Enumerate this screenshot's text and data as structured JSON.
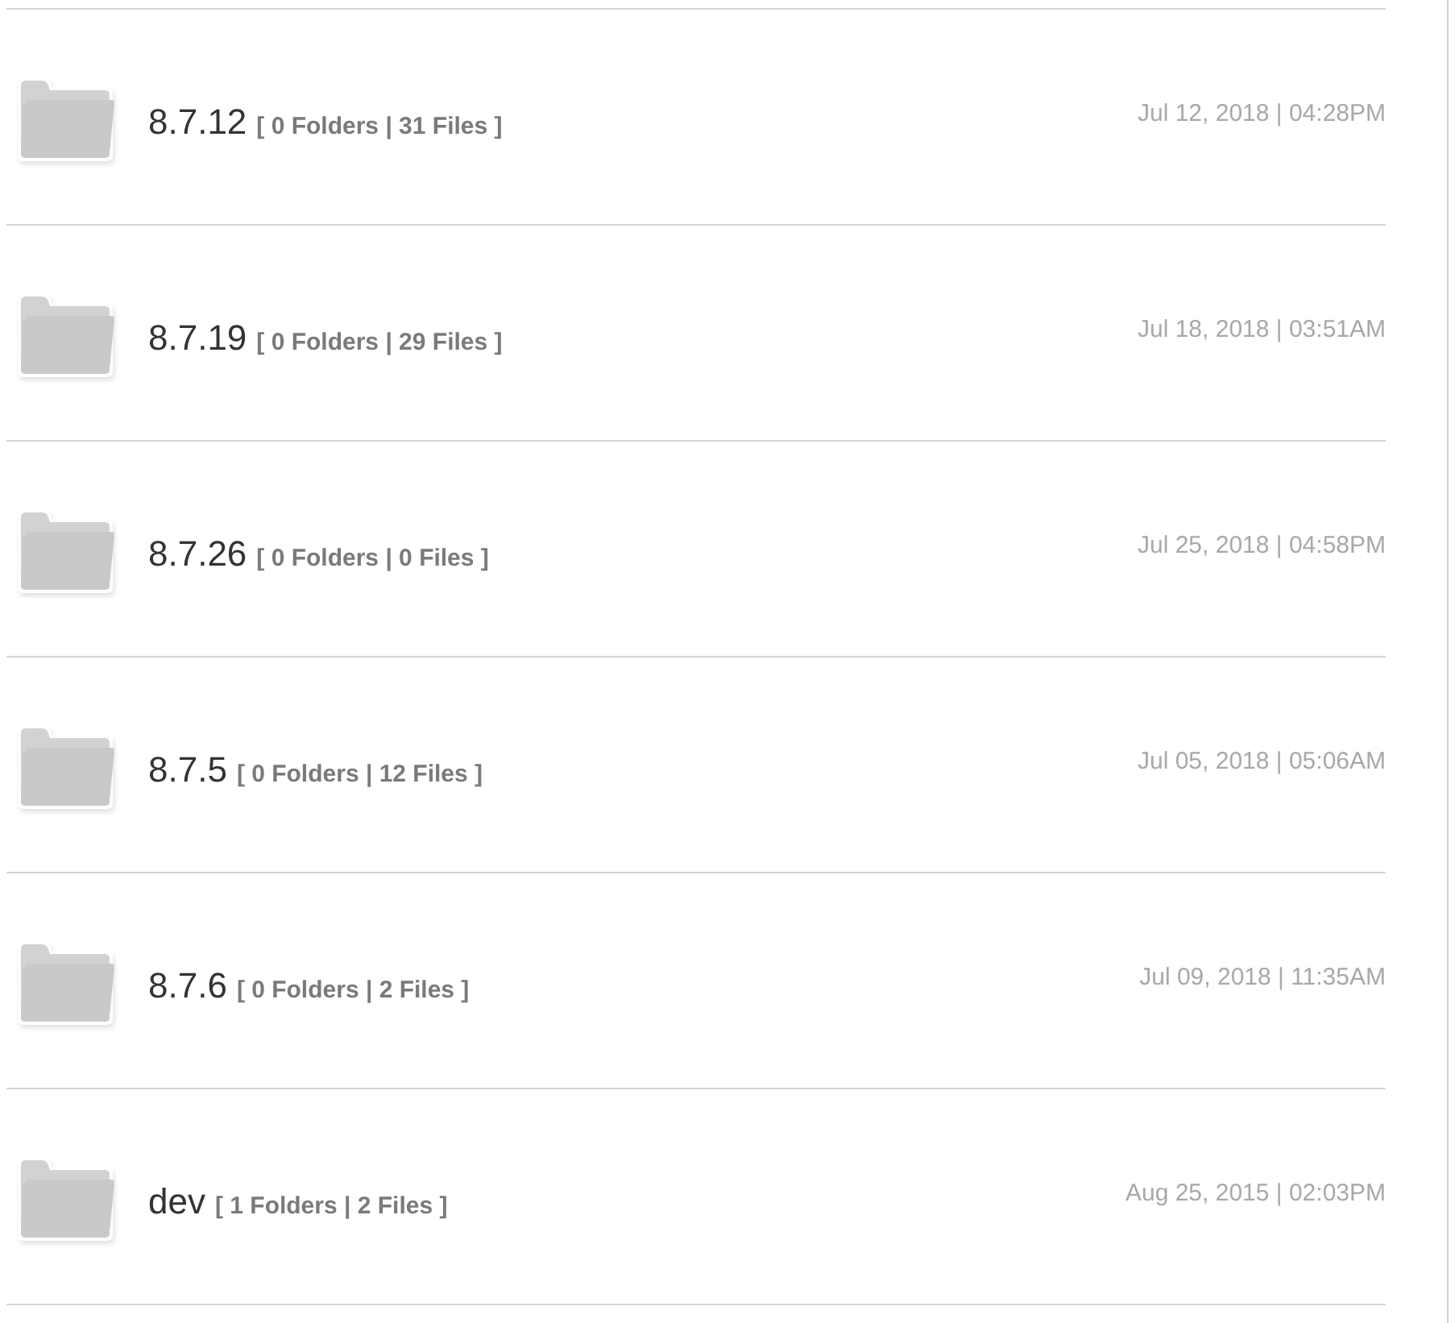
{
  "folders": [
    {
      "name": "8.7.12",
      "counts": "[ 0 Folders | 31 Files ]",
      "modified": "Jul 12, 2018 | 04:28PM"
    },
    {
      "name": "8.7.19",
      "counts": "[ 0 Folders | 29 Files ]",
      "modified": "Jul 18, 2018 | 03:51AM"
    },
    {
      "name": "8.7.26",
      "counts": "[ 0 Folders | 0 Files ]",
      "modified": "Jul 25, 2018 | 04:58PM"
    },
    {
      "name": "8.7.5",
      "counts": "[ 0 Folders | 12 Files ]",
      "modified": "Jul 05, 2018 | 05:06AM"
    },
    {
      "name": "8.7.6",
      "counts": "[ 0 Folders | 2 Files ]",
      "modified": "Jul 09, 2018 | 11:35AM"
    },
    {
      "name": "dev",
      "counts": "[ 1 Folders | 2 Files ]",
      "modified": "Aug 25, 2015 | 02:03PM"
    }
  ]
}
